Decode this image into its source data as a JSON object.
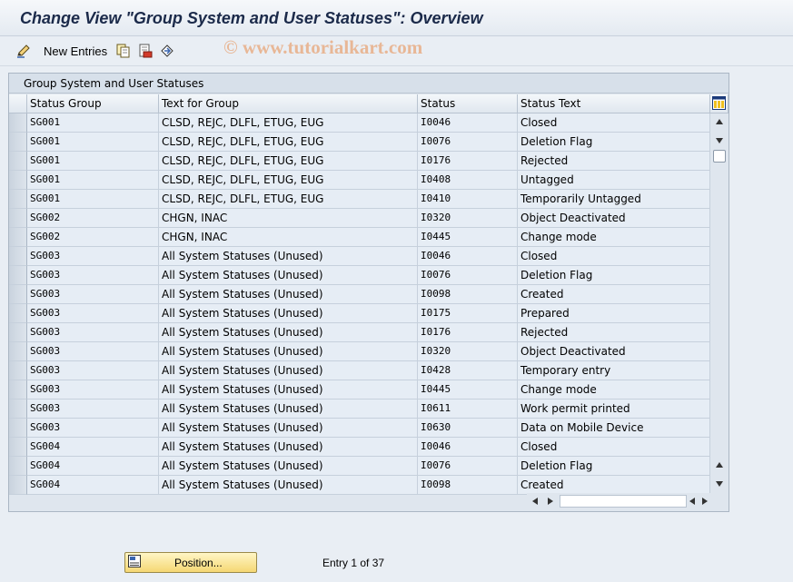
{
  "title": "Change View \"Group System and User Statuses\": Overview",
  "watermark": "© www.tutorialkart.com",
  "toolbar": {
    "new_entries_label": "New Entries",
    "icons": [
      "pen-icon",
      "copy-icon",
      "delete-icon",
      "undo-icon"
    ]
  },
  "table": {
    "caption": "Group System and User Statuses",
    "columns": [
      "Status Group",
      "Text for Group",
      "Status",
      "Status Text"
    ],
    "rows": [
      [
        "SG001",
        "CLSD, REJC, DLFL, ETUG, EUG",
        "I0046",
        "Closed"
      ],
      [
        "SG001",
        "CLSD, REJC, DLFL, ETUG, EUG",
        "I0076",
        "Deletion Flag"
      ],
      [
        "SG001",
        "CLSD, REJC, DLFL, ETUG, EUG",
        "I0176",
        "Rejected"
      ],
      [
        "SG001",
        "CLSD, REJC, DLFL, ETUG, EUG",
        "I0408",
        "Untagged"
      ],
      [
        "SG001",
        "CLSD, REJC, DLFL, ETUG, EUG",
        "I0410",
        "Temporarily Untagged"
      ],
      [
        "SG002",
        "CHGN, INAC",
        "I0320",
        "Object Deactivated"
      ],
      [
        "SG002",
        "CHGN, INAC",
        "I0445",
        "Change mode"
      ],
      [
        "SG003",
        "All System Statuses (Unused)",
        "I0046",
        "Closed"
      ],
      [
        "SG003",
        "All System Statuses (Unused)",
        "I0076",
        "Deletion Flag"
      ],
      [
        "SG003",
        "All System Statuses (Unused)",
        "I0098",
        "Created"
      ],
      [
        "SG003",
        "All System Statuses (Unused)",
        "I0175",
        "Prepared"
      ],
      [
        "SG003",
        "All System Statuses (Unused)",
        "I0176",
        "Rejected"
      ],
      [
        "SG003",
        "All System Statuses (Unused)",
        "I0320",
        "Object Deactivated"
      ],
      [
        "SG003",
        "All System Statuses (Unused)",
        "I0428",
        "Temporary entry"
      ],
      [
        "SG003",
        "All System Statuses (Unused)",
        "I0445",
        "Change mode"
      ],
      [
        "SG003",
        "All System Statuses (Unused)",
        "I0611",
        "Work permit printed"
      ],
      [
        "SG003",
        "All System Statuses (Unused)",
        "I0630",
        "Data on Mobile Device"
      ],
      [
        "SG004",
        "All System Statuses (Unused)",
        "I0046",
        "Closed"
      ],
      [
        "SG004",
        "All System Statuses (Unused)",
        "I0076",
        "Deletion Flag"
      ],
      [
        "SG004",
        "All System Statuses (Unused)",
        "I0098",
        "Created"
      ]
    ]
  },
  "footer": {
    "position_label": "Position...",
    "entry_info": "Entry 1 of 37"
  },
  "colors": {
    "background": "#e9eef4",
    "row_background": "#e6edf5",
    "button_yellow": "#f5d773"
  }
}
